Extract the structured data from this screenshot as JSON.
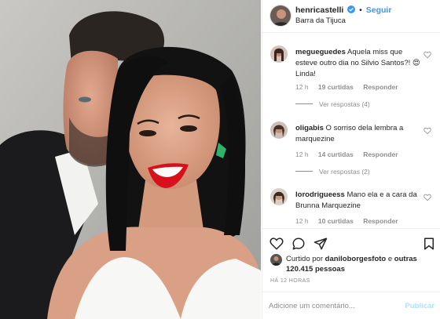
{
  "post": {
    "username": "henricastelli",
    "follow_label": "Seguir",
    "separator": "•",
    "location": "Barra da Tijuca"
  },
  "comments": [
    {
      "username": "megueguedes",
      "text": "Aquela miss que esteve outro dia no Silvio Santos?! 😍 Linda!",
      "time": "12 h",
      "likes": "19 curtidas",
      "reply": "Responder",
      "view_replies": "Ver respostas (4)"
    },
    {
      "username": "oligabis",
      "text": "O sorriso dela lembra a marquezine",
      "time": "12 h",
      "likes": "14 curtidas",
      "reply": "Responder",
      "view_replies": "Ver respostas (2)"
    },
    {
      "username": "lorodrigueess",
      "text": "Mano ela e a cara da Brunna Marquezine",
      "time": "12 h",
      "likes": "10 curtidas",
      "reply": "Responder"
    }
  ],
  "likes_summary": {
    "prefix": "Curtido por",
    "user": "daniloborgesfoto",
    "connector": "e",
    "others": "outras 120.415 pessoas"
  },
  "timestamp": "HÁ 12 HORAS",
  "add_comment": {
    "placeholder": "Adicione um comentário...",
    "publish_label": "Publicar"
  },
  "colors": {
    "accent": "#3897f0",
    "publish_disabled": "#b2dffc",
    "text": "#262626",
    "muted": "#8e8e8e",
    "lipstick": "#d8101c",
    "earring": "#2fb36b"
  },
  "icons": [
    "verified-badge-icon",
    "heart-icon",
    "comment-icon",
    "share-icon",
    "bookmark-icon"
  ]
}
